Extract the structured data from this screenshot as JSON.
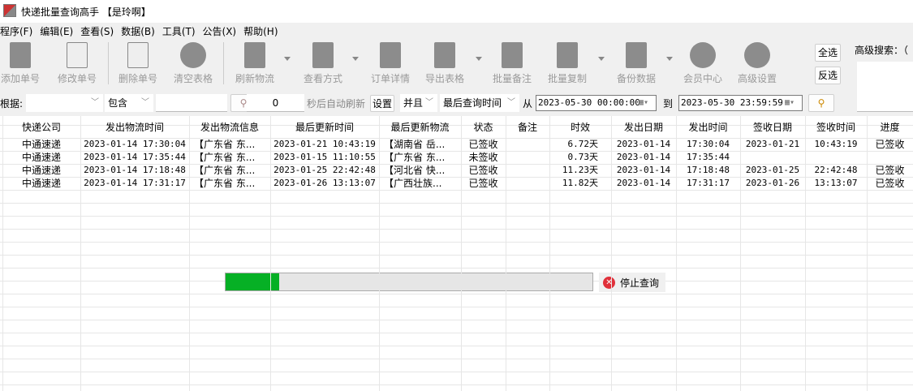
{
  "window": {
    "title": "快递批量查询高手 【是玲啊】"
  },
  "menu": [
    "程序(F)",
    "编辑(E)",
    "查看(S)",
    "数据(B)",
    "工具(T)",
    "公告(X)",
    "帮助(H)"
  ],
  "toolbar": [
    {
      "label": "添加单号",
      "icon": "document-icon"
    },
    {
      "label": "修改单号",
      "icon": "edit-pencil-icon"
    },
    {
      "label": "删除单号",
      "icon": "delete-document-icon"
    },
    {
      "label": "清空表格",
      "icon": "clear-x-icon"
    },
    {
      "label": "刷新物流",
      "icon": "refresh-document-icon"
    },
    {
      "label": "查看方式",
      "icon": "view-document-icon"
    },
    {
      "label": "订单详情",
      "icon": "order-detail-icon"
    },
    {
      "label": "导出表格",
      "icon": "export-icon"
    },
    {
      "label": "批量备注",
      "icon": "scroll-icon"
    },
    {
      "label": "批量复制",
      "icon": "copy-icon"
    },
    {
      "label": "备份数据",
      "icon": "backup-icon"
    },
    {
      "label": "会员中心",
      "icon": "clock-icon"
    },
    {
      "label": "高级设置",
      "icon": "settings-icon"
    }
  ],
  "select_all": "全选",
  "invert_select": "反选",
  "advanced_search": "高级搜索：（",
  "filter": {
    "by_label": "根据:",
    "by_value": "",
    "match": "包含",
    "keyword": "",
    "refresh_seconds": "0",
    "refresh_label": "秒后自动刷新",
    "set_btn": "设置",
    "logic": "并且",
    "time_field": "最后查询时间",
    "from_label": "从",
    "from": "2023-05-30 00:00:00",
    "to_label": "到",
    "to": "2023-05-30 23:59:59"
  },
  "table": {
    "columns": [
      "快递公司",
      "发出物流时间",
      "发出物流信息",
      "最后更新时间",
      "最后更新物流",
      "状态",
      "备注",
      "时效",
      "发出日期",
      "发出时间",
      "签收日期",
      "签收时间",
      "进度"
    ],
    "rows": [
      [
        "中通速递",
        "2023-01-14 17:30:04",
        "【广东省 东...",
        "2023-01-21 10:43:19",
        "【湖南省 岳...",
        "已签收",
        "",
        "6.72天",
        "2023-01-14",
        "17:30:04",
        "2023-01-21",
        "10:43:19",
        "已签收"
      ],
      [
        "中通速递",
        "2023-01-14 17:35:44",
        "【广东省 东...",
        "2023-01-15 11:10:55",
        "【广东省 东...",
        "未签收",
        "",
        "0.73天",
        "2023-01-14",
        "17:35:44",
        "",
        "",
        ""
      ],
      [
        "中通速递",
        "2023-01-14 17:18:48",
        "【广东省 东...",
        "2023-01-25 22:42:48",
        "【河北省 快...",
        "已签收",
        "",
        "11.23天",
        "2023-01-14",
        "17:18:48",
        "2023-01-25",
        "22:42:48",
        "已签收"
      ],
      [
        "中通速递",
        "2023-01-14 17:31:17",
        "【广东省 东...",
        "2023-01-26 13:13:07",
        "【广西壮族...",
        "已签收",
        "",
        "11.82天",
        "2023-01-14",
        "17:31:17",
        "2023-01-26",
        "13:13:07",
        "已签收"
      ]
    ]
  },
  "progress": {
    "percent": 14.5,
    "stop_label": "停止查询"
  },
  "colors": {
    "progress": "#06b025",
    "stop": "#e0303a"
  }
}
